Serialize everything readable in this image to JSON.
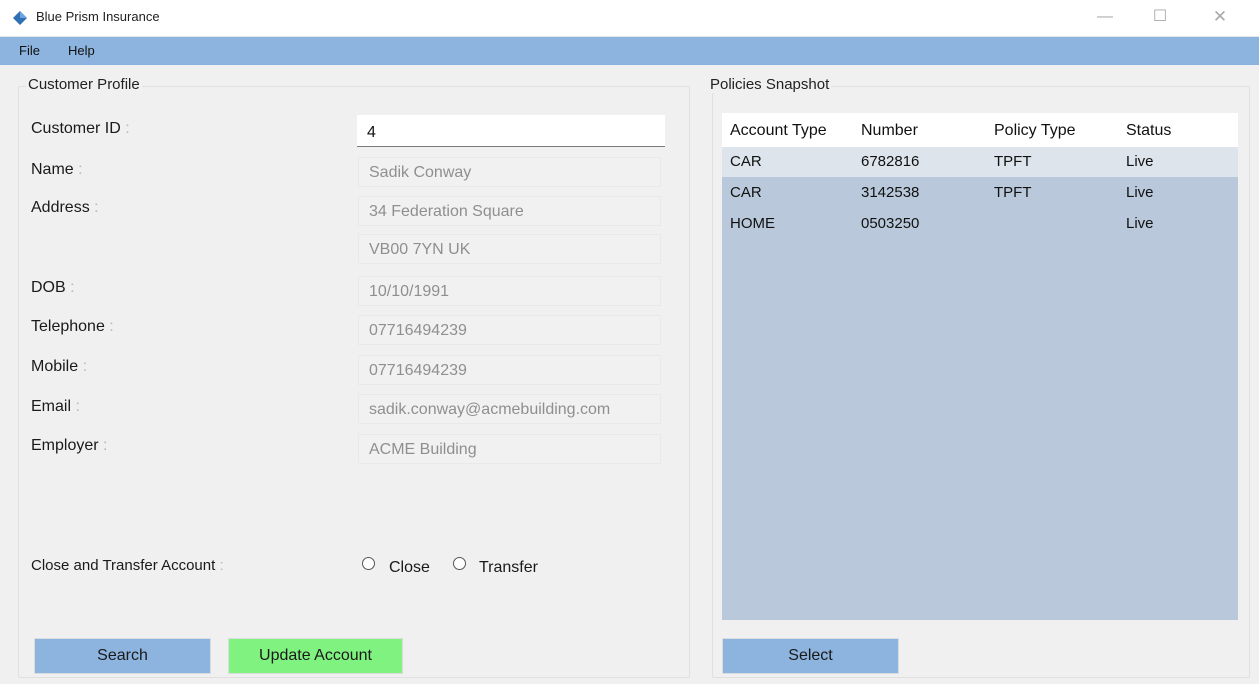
{
  "window": {
    "title": "Blue Prism Insurance",
    "controls": {
      "minimize": "—",
      "maximize": "☐",
      "close": "✕"
    }
  },
  "menu": {
    "items": [
      "File",
      "Help"
    ]
  },
  "customer_profile": {
    "title": "Customer Profile",
    "customer_id": {
      "label": "Customer ID",
      "value": "4"
    },
    "name": {
      "label": "Name",
      "value": "Sadik Conway"
    },
    "address": {
      "label": "Address",
      "line1": "34 Federation Square",
      "line2": "VB00 7YN UK"
    },
    "dob": {
      "label": "DOB",
      "value": "10/10/1991"
    },
    "telephone": {
      "label": "Telephone",
      "value": "07716494239"
    },
    "mobile": {
      "label": "Mobile",
      "value": "07716494239"
    },
    "email": {
      "label": "Email",
      "value": "sadik.conway@acmebuilding.com"
    },
    "employer": {
      "label": "Employer",
      "value": "ACME Building"
    },
    "close_transfer": {
      "label": "Close and Transfer Account",
      "options": [
        "Close",
        "Transfer"
      ]
    },
    "buttons": {
      "search": "Search",
      "update": "Update Account"
    }
  },
  "policies_snapshot": {
    "title": "Policies Snapshot",
    "columns": [
      "Account Type",
      "Number",
      "Policy Type",
      "Status"
    ],
    "rows": [
      [
        "CAR",
        "6782816",
        "TPFT",
        "Live"
      ],
      [
        "CAR",
        "3142538",
        "TPFT",
        "Live"
      ],
      [
        "HOME",
        "0503250",
        "",
        "Live"
      ]
    ],
    "select_button": "Select"
  },
  "colors": {
    "menubar": "#8cb4de",
    "blue_button": "#8cb4de",
    "green_button": "#7ff27f",
    "grid_background": "#b9c9db"
  }
}
